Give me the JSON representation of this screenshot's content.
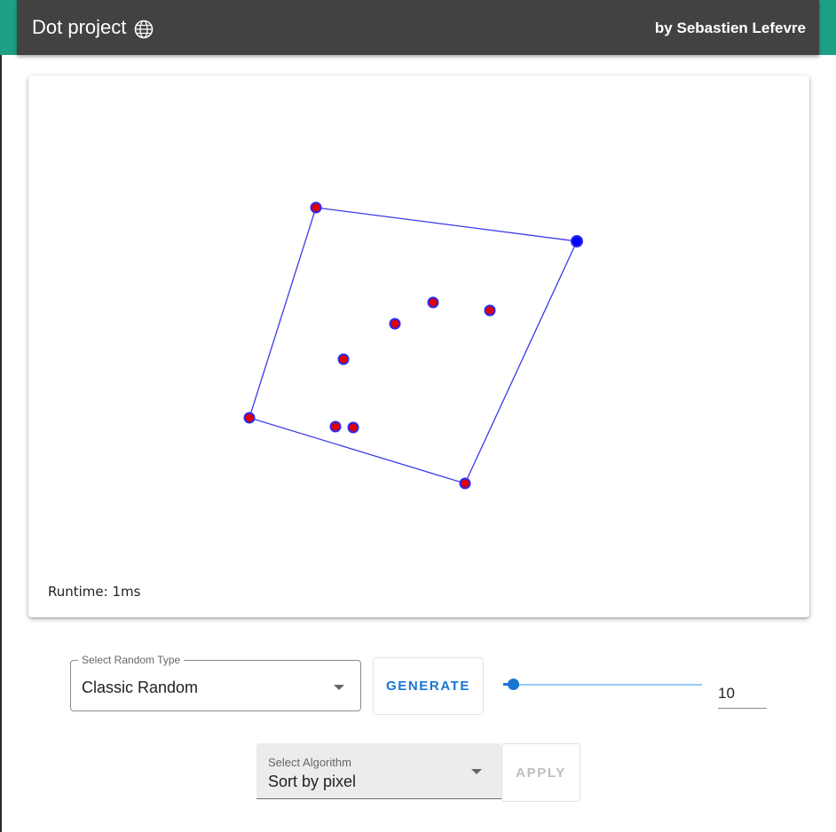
{
  "header": {
    "title": "Dot project",
    "globe_icon": "globe-icon",
    "author": "by Sebastien Lefevre"
  },
  "canvas": {
    "runtime_text": "Runtime: 1ms",
    "hull_color": "#3a3ae8",
    "point_fill": "#e00000",
    "point_stroke": "#2a2af0",
    "selected_point_fill": "#0000ff"
  },
  "controls": {
    "random_type": {
      "label": "Select Random Type",
      "value": "Classic Random"
    },
    "generate_label": "GENERATE",
    "point_count": "10",
    "algorithm": {
      "label": "Select Algorithm",
      "value": "Sort by pixel"
    },
    "apply_label": "APPLY"
  },
  "colors": {
    "appbar": "#424242",
    "accent": "#1ea086",
    "primary": "#1976d2"
  }
}
